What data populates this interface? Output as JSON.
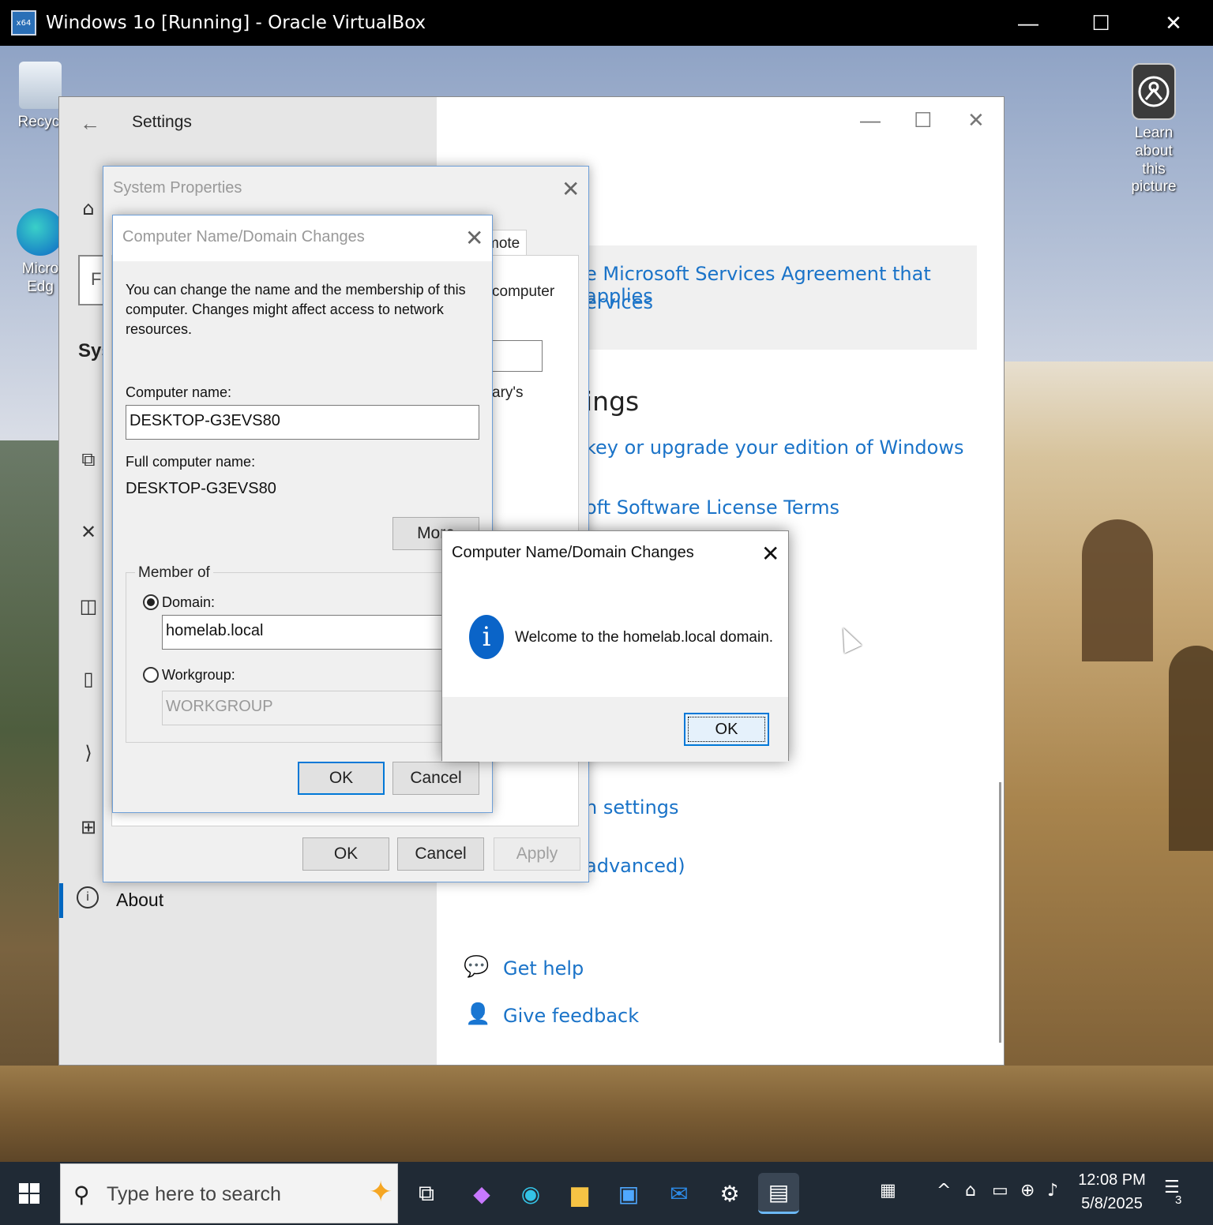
{
  "vbox": {
    "title": "Windows 1o [Running] - Oracle VirtualBox",
    "logo_text": "x64\n10",
    "minimize": "—",
    "maximize": "☐",
    "close": "✕"
  },
  "desktop": {
    "recycle_label": "Recycl",
    "edge_label": "Micro\nEdg",
    "learn_label": "Learn about\nthis picture"
  },
  "settings": {
    "title": "Settings",
    "search_partial": "Fi",
    "section_partial": "Sys",
    "about_label": "About",
    "agreement_line1": "e Microsoft Services Agreement that applies",
    "agreement_line2": "ervices",
    "heading_partial": "ings",
    "upgrade_link": "key or upgrade your edition of Windows",
    "license_link": "oft Software License Terms",
    "settings_link": "n settings",
    "advanced_link": "advanced)",
    "get_help": "Get help",
    "give_feedback": "Give feedback"
  },
  "system_properties": {
    "title": "System Properties",
    "tab_partial": "mote",
    "computer_partial": "computer",
    "library_partial": "ary's",
    "ok": "OK",
    "cancel": "Cancel",
    "apply": "Apply"
  },
  "name_dialog": {
    "title": "Computer Name/Domain Changes",
    "description": "You can change the name and the membership of this computer. Changes might affect access to network resources.",
    "computer_name_label": "Computer name:",
    "computer_name_value": "DESKTOP-G3EVS80",
    "full_name_label": "Full computer name:",
    "full_name_value": "DESKTOP-G3EVS80",
    "more_button": "More",
    "member_of_label": "Member of",
    "domain_label": "Domain:",
    "domain_value": "homelab.local",
    "workgroup_label": "Workgroup:",
    "workgroup_value": "WORKGROUP",
    "ok": "OK",
    "cancel": "Cancel"
  },
  "message_box": {
    "title": "Computer Name/Domain Changes",
    "message": "Welcome to the homelab.local domain.",
    "ok": "OK"
  },
  "taskbar": {
    "search_placeholder": "Type here to search",
    "time": "12:08 PM",
    "date": "5/8/2025",
    "notification_count": "3"
  }
}
